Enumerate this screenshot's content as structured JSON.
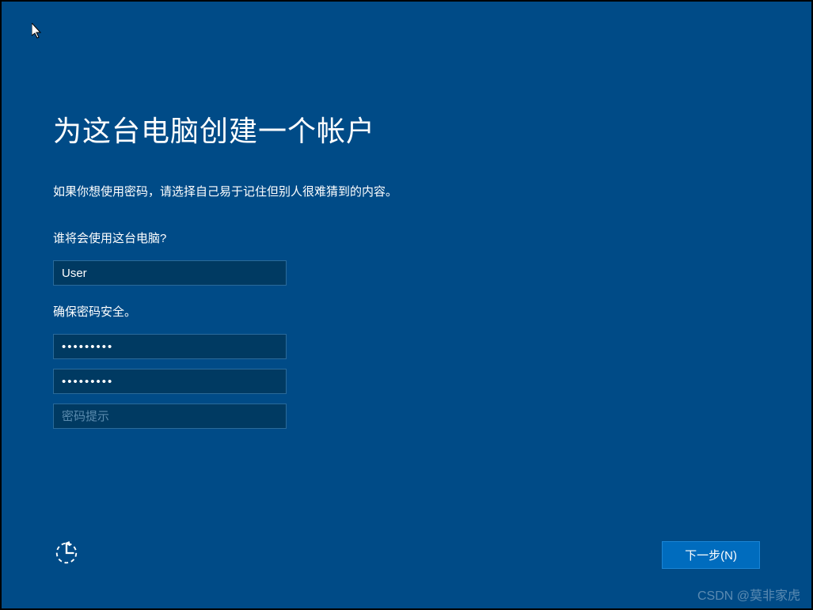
{
  "page": {
    "title": "为这台电脑创建一个帐户",
    "subtitle": "如果你想使用密码，请选择自己易于记住但别人很难猜到的内容。"
  },
  "form": {
    "username_label": "谁将会使用这台电脑?",
    "username_value": "User",
    "password_label": "确保密码安全。",
    "password_value": "•••••••••",
    "password_confirm_value": "•••••••••",
    "password_hint_placeholder": "密码提示"
  },
  "footer": {
    "next_label": "下一步(N)"
  },
  "watermark": "CSDN @莫非家虎"
}
